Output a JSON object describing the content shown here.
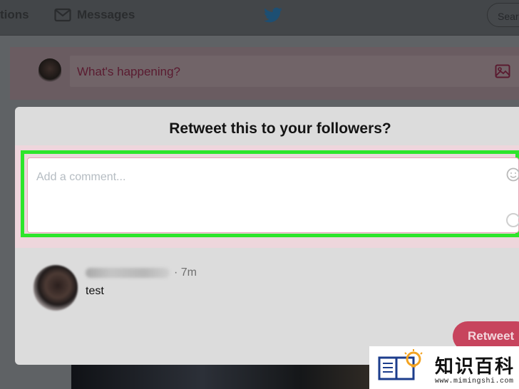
{
  "topbar": {
    "notifications_label": "tions",
    "messages_label": "Messages",
    "search_label": "Sear"
  },
  "compose": {
    "placeholder": "What's happening?"
  },
  "modal": {
    "title": "Retweet this to your followers?",
    "comment_placeholder": "Add a comment...",
    "tweet": {
      "separator": "·",
      "time": "7m",
      "text": "test"
    },
    "retweet_button": "Retweet"
  },
  "watermark": {
    "title": "知识百科",
    "url": "www.mimingshi.com"
  },
  "colors": {
    "accent": "#c7445d",
    "highlight": "#2ee52b",
    "twitter_blue": "#1d4f73"
  },
  "icons": {
    "messages": "envelope-icon",
    "brand": "twitter-bird-icon",
    "media": "image-icon",
    "emoji": "emoji-icon",
    "counter": "character-counter-icon",
    "watermark": "book-lightbulb-logo-icon"
  }
}
